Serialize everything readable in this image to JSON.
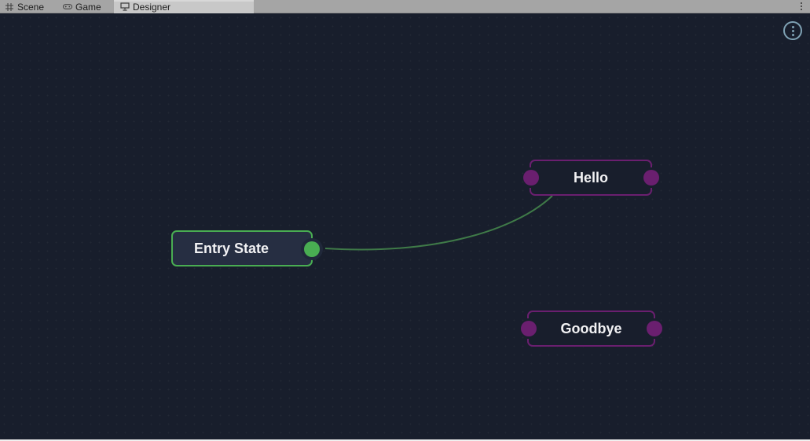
{
  "tabs": [
    {
      "label": "Scene",
      "icon": "grid-icon"
    },
    {
      "label": "Game",
      "icon": "gamepad-icon"
    },
    {
      "label": "Designer",
      "icon": "monitor-icon",
      "active": true
    }
  ],
  "canvas": {
    "options_icon": "more-vertical-circle-icon",
    "nodes": {
      "entry": {
        "label": "Entry State",
        "accent": "#49ad52"
      },
      "hello": {
        "label": "Hello",
        "accent": "#6a1f6f"
      },
      "goodbye": {
        "label": "Goodbye",
        "accent": "#6a1f6f"
      }
    },
    "edges": [
      {
        "from": "Entry State",
        "to": "Hello",
        "color": "#3f7a48"
      }
    ]
  },
  "colors": {
    "background": "#181e2c",
    "tabbar": "#a5a5a5",
    "active_tab": "#c8c8c8"
  }
}
